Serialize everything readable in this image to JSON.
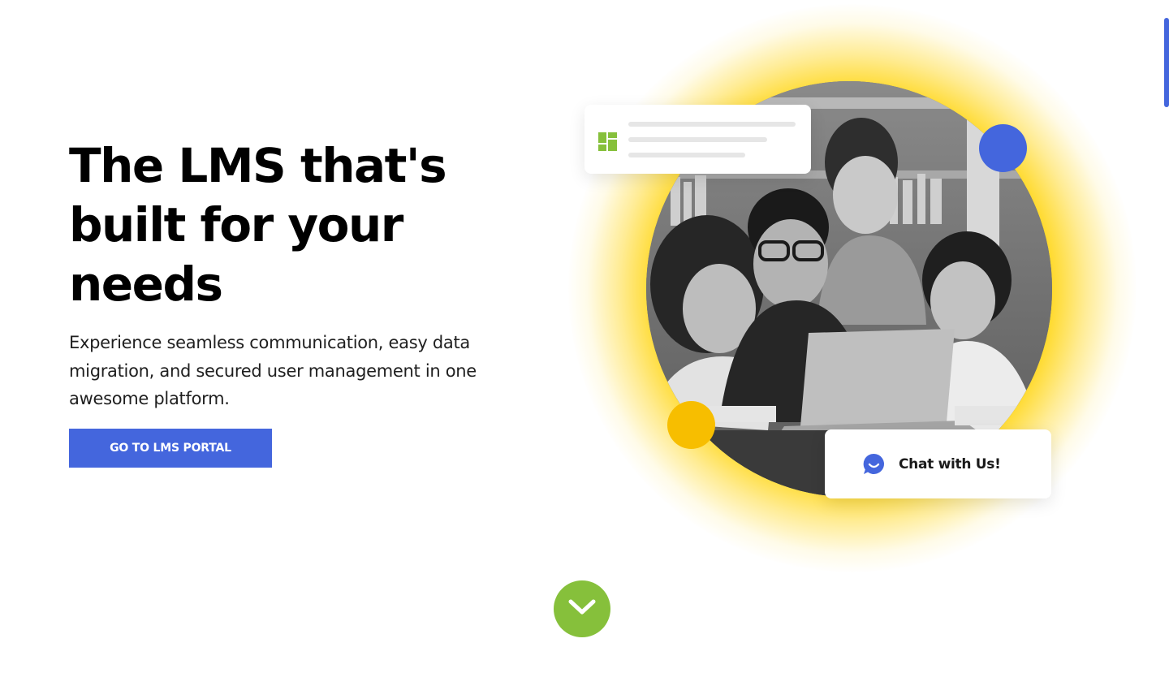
{
  "hero": {
    "title": "The LMS that's built for your needs",
    "description": "Experience seamless communication, easy data migration, and secured user management in one awesome platform.",
    "cta_label": "GO TO LMS PORTAL"
  },
  "visual": {
    "photo_subject": "students-around-laptop",
    "chat_label": "Chat with Us!",
    "dashboard_icon": "dashboard-icon",
    "chat_icon": "chat-bubble-icon",
    "scroll_icon": "chevron-down-icon"
  },
  "colors": {
    "primary": "#4466dd",
    "accent_yellow": "#ffd200",
    "accent_green": "#86c03b",
    "dot_yellow": "#f7be00"
  }
}
